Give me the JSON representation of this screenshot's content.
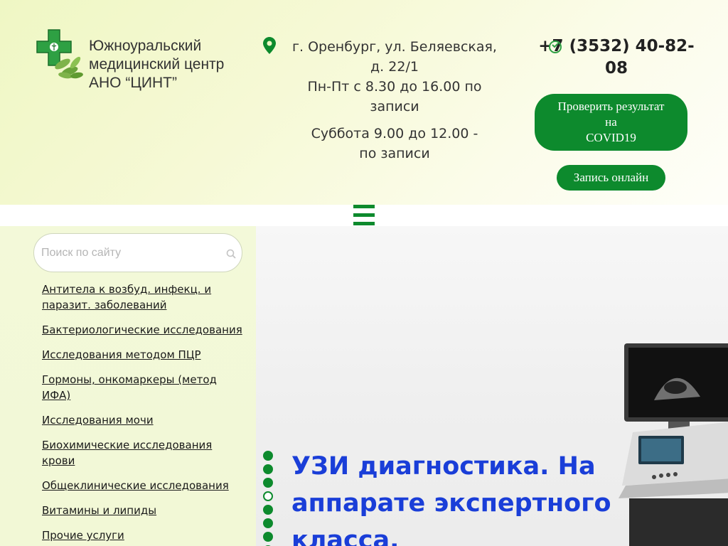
{
  "header": {
    "org_name_line1": "Южноуральский",
    "org_name_line2": "медицинский центр",
    "org_name_line3": "АНО “ЦИНТ”",
    "address_line1": "г. Оренбург, ул. Беляевская,",
    "address_line2": "д. 22/1",
    "hours_line1": "Пн-Пт с 8.30 до 16.00 по",
    "hours_line2": "записи",
    "saturday_line1": "Суббота 9.00 до 12.00 -",
    "saturday_line2": "по записи",
    "phone_line1": "+7 (3532) 40-82-",
    "phone_line2": "08",
    "covid_button_line1": "Проверить результат",
    "covid_button_line2": "на",
    "covid_button_line3": "COVID19",
    "online_button": "Запись онлайн"
  },
  "search": {
    "placeholder": "Поиск по сайту",
    "value": ""
  },
  "sidebar_menu": [
    {
      "label_line1": "Антитела к возбуд. инфекц. и ",
      "label_line2": "паразит. заболеваний"
    },
    {
      "label_line1": "Бактериологические исследования",
      "label_line2": ""
    },
    {
      "label_line1": "Исследования методом ПЦР",
      "label_line2": ""
    },
    {
      "label_line1": "Гормоны, онкомаркеры (метод ",
      "label_line2": "ИФА)"
    },
    {
      "label_line1": "Исследования мочи",
      "label_line2": ""
    },
    {
      "label_line1": "Биохимические исследования ",
      "label_line2": "крови"
    },
    {
      "label_line1": "Общеклинические исследования",
      "label_line2": ""
    },
    {
      "label_line1": "Витамины и липиды",
      "label_line2": ""
    },
    {
      "label_line1": "Прочие услуги",
      "label_line2": ""
    }
  ],
  "slider": {
    "title_line1": "УЗИ диагностика. На",
    "title_line2": "аппарате экспертного",
    "title_line3": "класса.",
    "dot_count": 8,
    "active_dot": 4
  },
  "colors": {
    "brand_green": "#0d8a2d",
    "title_blue": "#1a3ed8",
    "header_bg": "#eff7c4",
    "sidebar_bg": "#f3f9d9"
  },
  "icons": {
    "logo": "green-cross-logo-icon",
    "address": "map-pin-icon",
    "phone": "phone-icon",
    "search": "search-icon",
    "menu": "hamburger-menu-icon"
  }
}
